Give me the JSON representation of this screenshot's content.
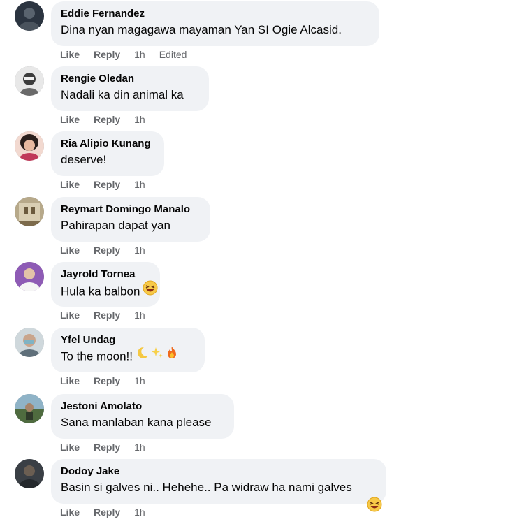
{
  "comments": [
    {
      "author": "Eddie Fernandez",
      "text": "Dina nyan magagawa mayaman Yan SI Ogie Alcasid.",
      "like": "Like",
      "reply": "Reply",
      "time": "1h",
      "edited": "Edited",
      "avatar": "avatar-photo-1",
      "color": "#2b3440"
    },
    {
      "author": "Rengie Oledan",
      "text": "Nadali ka din animal ka",
      "like": "Like",
      "reply": "Reply",
      "time": "1h",
      "avatar": "avatar-photo-2",
      "color": "#9aa0a6"
    },
    {
      "author": "Ria Alipio Kunang",
      "text": "deserve!",
      "like": "Like",
      "reply": "Reply",
      "time": "1h",
      "avatar": "avatar-photo-3",
      "color": "#c58a6a"
    },
    {
      "author": "Reymart Domingo Manalo",
      "text": "Pahirapan dapat yan",
      "like": "Like",
      "reply": "Reply",
      "time": "1h",
      "avatar": "avatar-photo-4",
      "color": "#8a7a5c"
    },
    {
      "author": "Jayrold Tornea",
      "text": "Hula ka balbon",
      "like": "Like",
      "reply": "Reply",
      "time": "1h",
      "avatar": "avatar-photo-5",
      "color": "#7c4fa0",
      "emoji": [
        "laughing-emoji"
      ]
    },
    {
      "author": "Yfel Undag",
      "text": "To the moon!!",
      "like": "Like",
      "reply": "Reply",
      "time": "1h",
      "avatar": "avatar-photo-6",
      "color": "#6f8f9a",
      "emoji": [
        "crescent-moon-emoji",
        "sparkles-emoji",
        "fire-emoji"
      ]
    },
    {
      "author": "Jestoni Amolato",
      "text": "Sana manlaban kana please",
      "like": "Like",
      "reply": "Reply",
      "time": "1h",
      "avatar": "avatar-photo-7",
      "color": "#5a7a5a"
    },
    {
      "author": "Dodoy Jake",
      "text": "Basin si galves ni.. Hehehe.. Pa widraw ha nami galves",
      "like": "Like",
      "reply": "Reply",
      "time": "1h",
      "avatar": "avatar-photo-8",
      "color": "#3a3f45",
      "emoji": [
        "laughing-emoji"
      ]
    }
  ]
}
